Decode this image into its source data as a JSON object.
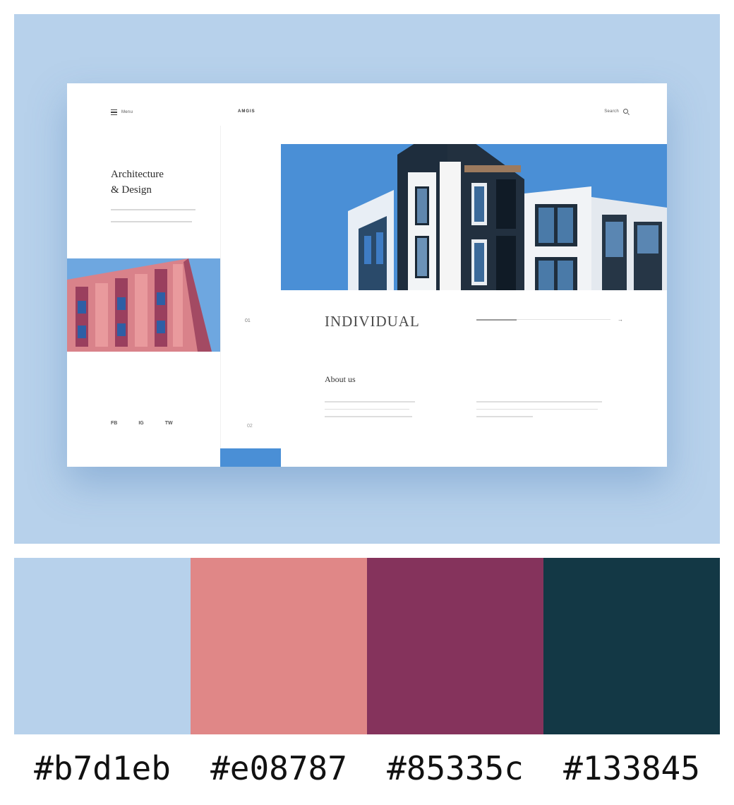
{
  "mockup": {
    "nav": {
      "menu_label": "Menu",
      "logo": "AMGIS",
      "search_label": "Search"
    },
    "hero": {
      "title_line1": "Architecture",
      "title_line2": "& Design"
    },
    "slider": {
      "index": "01",
      "index_bottom": "02",
      "heading": "INDIVIDUAL",
      "progress": 0.3
    },
    "about": {
      "title": "About us"
    },
    "social": [
      "FB",
      "IG",
      "TW"
    ]
  },
  "palette": [
    {
      "hex": "#b7d1eb",
      "label": "#b7d1eb"
    },
    {
      "hex": "#e08787",
      "label": "#e08787"
    },
    {
      "hex": "#85335c",
      "label": "#85335c"
    },
    {
      "hex": "#133845",
      "label": "#133845"
    }
  ]
}
